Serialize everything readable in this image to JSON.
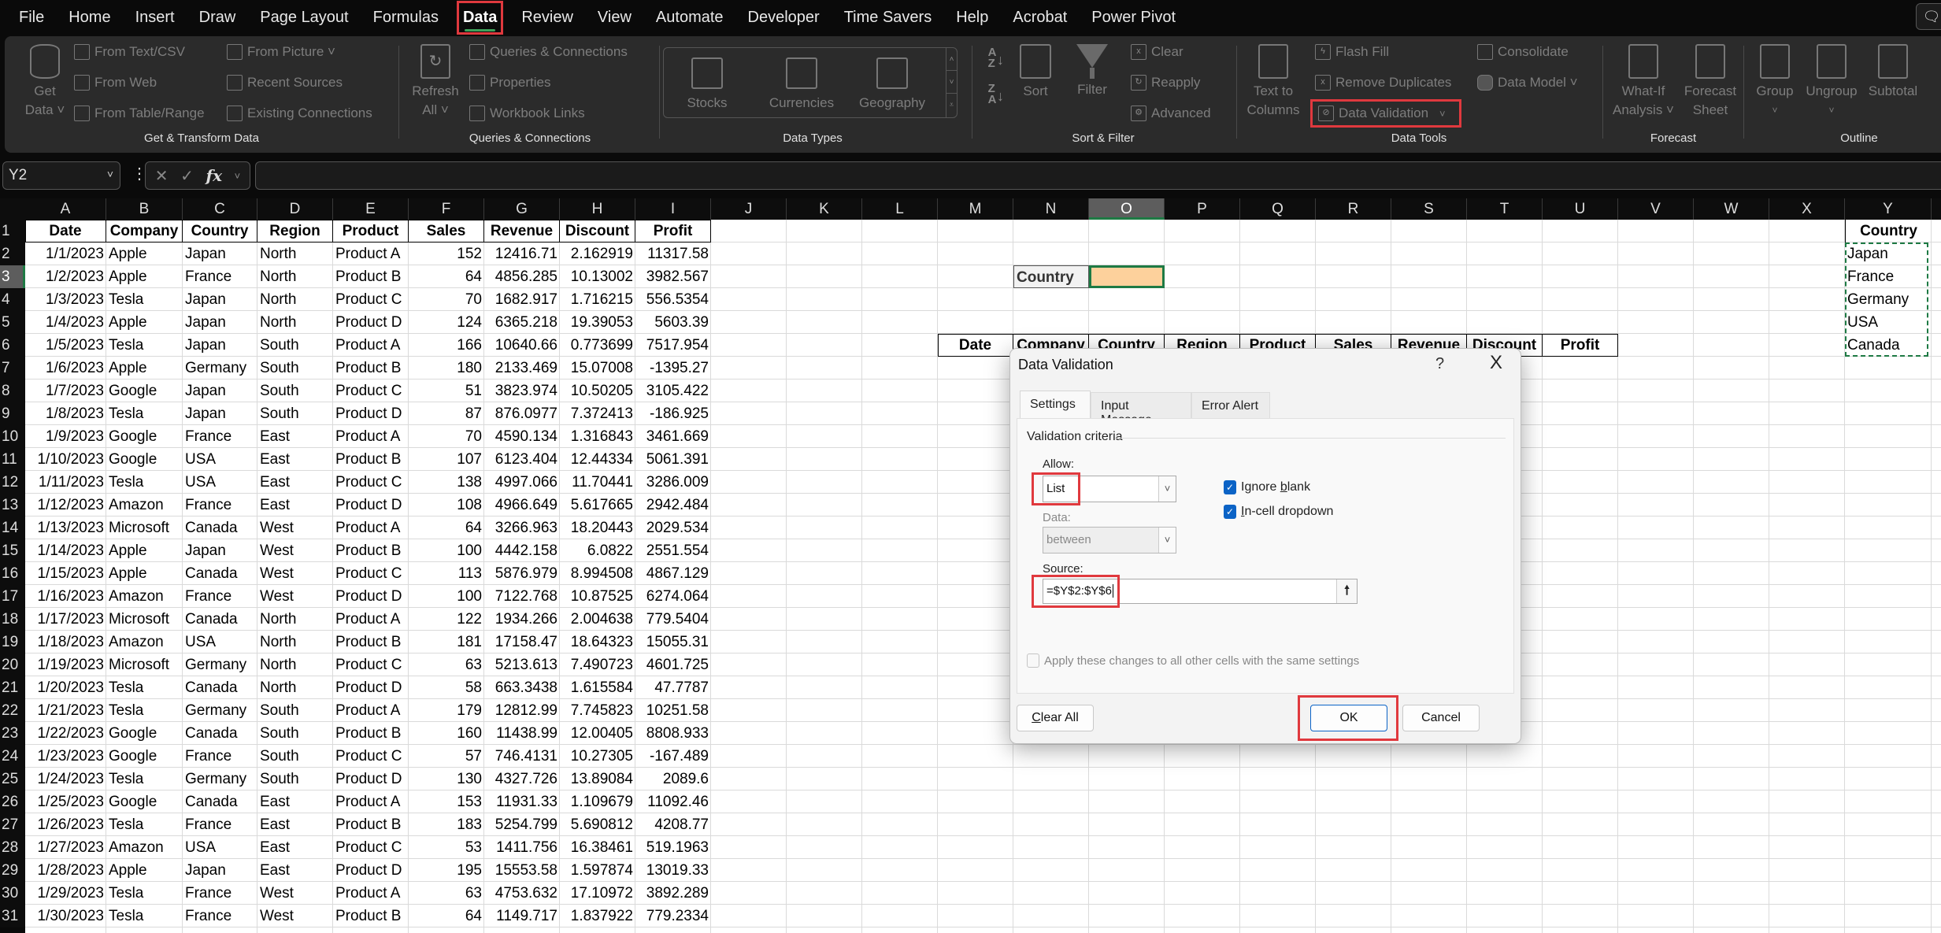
{
  "menu": {
    "items": [
      "File",
      "Home",
      "Insert",
      "Draw",
      "Page Layout",
      "Formulas",
      "Data",
      "Review",
      "View",
      "Automate",
      "Developer",
      "Time Savers",
      "Help",
      "Acrobat",
      "Power Pivot"
    ],
    "active": "Data"
  },
  "ribbon": {
    "get_transform": {
      "label": "Get & Transform Data",
      "get_data_1": "Get",
      "get_data_2": "Data ˅",
      "from_text_csv": "From Text/CSV",
      "from_web": "From Web",
      "from_table_range": "From Table/Range",
      "from_picture": "From Picture ˅",
      "recent_sources": "Recent Sources",
      "existing_connections": "Existing Connections"
    },
    "queries": {
      "label": "Queries & Connections",
      "refresh_1": "Refresh",
      "refresh_2": "All ˅",
      "queries_connections": "Queries & Connections",
      "properties": "Properties",
      "workbook_links": "Workbook Links"
    },
    "data_types": {
      "label": "Data Types",
      "stocks": "Stocks",
      "currencies": "Currencies",
      "geography": "Geography"
    },
    "sort_filter": {
      "label": "Sort & Filter",
      "sort_az": "A↓Z",
      "sort_za": "Z↓A",
      "sort": "Sort",
      "filter": "Filter",
      "clear": "Clear",
      "reapply": "Reapply",
      "advanced": "Advanced"
    },
    "data_tools": {
      "label": "Data Tools",
      "text_to_columns_1": "Text to",
      "text_to_columns_2": "Columns",
      "flash_fill": "Flash Fill",
      "remove_duplicates": "Remove Duplicates",
      "data_validation": "Data Validation",
      "consolidate": "Consolidate",
      "data_model": "Data Model ˅"
    },
    "forecast": {
      "label": "Forecast",
      "what_if_1": "What-If",
      "what_if_2": "Analysis ˅",
      "forecast_sheet_1": "Forecast",
      "forecast_sheet_2": "Sheet"
    },
    "outline": {
      "label": "Outline",
      "group": "Group",
      "ungroup": "Ungroup",
      "subtotal": "Subtotal"
    }
  },
  "formula_bar": {
    "name_box": "Y2",
    "formula": ""
  },
  "grid": {
    "columns": [
      "A",
      "B",
      "C",
      "D",
      "E",
      "F",
      "G",
      "H",
      "I",
      "J",
      "K",
      "L",
      "M",
      "N",
      "O",
      "P",
      "Q",
      "R",
      "S",
      "T",
      "U",
      "V",
      "W",
      "X",
      "Y"
    ],
    "selected_column": "O",
    "selected_row": 3,
    "row_numbers": [
      1,
      2,
      3,
      4,
      5,
      6,
      7,
      8,
      9,
      10,
      11,
      12,
      13,
      14,
      15,
      16,
      17,
      18,
      19,
      20,
      21,
      22,
      23,
      24,
      25,
      26,
      27,
      28,
      29,
      30,
      31
    ],
    "table_headers": [
      "Date",
      "Company",
      "Country",
      "Region",
      "Product",
      "Sales",
      "Revenue",
      "Discount",
      "Profit"
    ],
    "rows": [
      [
        "1/1/2023",
        "Apple",
        "Japan",
        "North",
        "Product A",
        "152",
        "12416.71",
        "2.162919",
        "11317.58"
      ],
      [
        "1/2/2023",
        "Apple",
        "France",
        "North",
        "Product B",
        "64",
        "4856.285",
        "10.13002",
        "3982.567"
      ],
      [
        "1/3/2023",
        "Tesla",
        "Japan",
        "North",
        "Product C",
        "70",
        "1682.917",
        "1.716215",
        "556.5354"
      ],
      [
        "1/4/2023",
        "Apple",
        "Japan",
        "North",
        "Product D",
        "124",
        "6365.218",
        "19.39053",
        "5603.39"
      ],
      [
        "1/5/2023",
        "Tesla",
        "Japan",
        "South",
        "Product A",
        "166",
        "10640.66",
        "0.773699",
        "7517.954"
      ],
      [
        "1/6/2023",
        "Apple",
        "Germany",
        "South",
        "Product B",
        "180",
        "2133.469",
        "15.07008",
        "-1395.27"
      ],
      [
        "1/7/2023",
        "Google",
        "Japan",
        "South",
        "Product C",
        "51",
        "3823.974",
        "10.50205",
        "3105.422"
      ],
      [
        "1/8/2023",
        "Tesla",
        "Japan",
        "South",
        "Product D",
        "87",
        "876.0977",
        "7.372413",
        "-186.925"
      ],
      [
        "1/9/2023",
        "Google",
        "France",
        "East",
        "Product A",
        "70",
        "4590.134",
        "1.316843",
        "3461.669"
      ],
      [
        "1/10/2023",
        "Google",
        "USA",
        "East",
        "Product B",
        "107",
        "6123.404",
        "12.44334",
        "5061.391"
      ],
      [
        "1/11/2023",
        "Tesla",
        "USA",
        "East",
        "Product C",
        "138",
        "4997.066",
        "11.70441",
        "3286.009"
      ],
      [
        "1/12/2023",
        "Amazon",
        "France",
        "East",
        "Product D",
        "108",
        "4966.649",
        "5.617665",
        "2942.484"
      ],
      [
        "1/13/2023",
        "Microsoft",
        "Canada",
        "West",
        "Product A",
        "64",
        "3266.963",
        "18.20443",
        "2029.534"
      ],
      [
        "1/14/2023",
        "Apple",
        "Japan",
        "West",
        "Product B",
        "100",
        "4442.158",
        "6.0822",
        "2551.554"
      ],
      [
        "1/15/2023",
        "Apple",
        "Canada",
        "West",
        "Product C",
        "113",
        "5876.979",
        "8.994508",
        "4867.129"
      ],
      [
        "1/16/2023",
        "Amazon",
        "France",
        "West",
        "Product D",
        "100",
        "7122.768",
        "10.87525",
        "6274.064"
      ],
      [
        "1/17/2023",
        "Microsoft",
        "Canada",
        "North",
        "Product A",
        "122",
        "1934.266",
        "2.004638",
        "779.5404"
      ],
      [
        "1/18/2023",
        "Amazon",
        "USA",
        "North",
        "Product B",
        "181",
        "17158.47",
        "18.64323",
        "15055.31"
      ],
      [
        "1/19/2023",
        "Microsoft",
        "Germany",
        "North",
        "Product C",
        "63",
        "5213.613",
        "7.490723",
        "4601.725"
      ],
      [
        "1/20/2023",
        "Tesla",
        "Canada",
        "North",
        "Product D",
        "58",
        "663.3438",
        "1.615584",
        "47.7787"
      ],
      [
        "1/21/2023",
        "Tesla",
        "Germany",
        "South",
        "Product A",
        "179",
        "12812.99",
        "7.745823",
        "10251.58"
      ],
      [
        "1/22/2023",
        "Google",
        "Canada",
        "South",
        "Product B",
        "160",
        "11438.99",
        "12.00405",
        "8808.933"
      ],
      [
        "1/23/2023",
        "Google",
        "France",
        "South",
        "Product C",
        "57",
        "746.4131",
        "10.27305",
        "-167.489"
      ],
      [
        "1/24/2023",
        "Tesla",
        "Germany",
        "South",
        "Product D",
        "130",
        "4327.726",
        "13.89084",
        "2089.6"
      ],
      [
        "1/25/2023",
        "Google",
        "Canada",
        "East",
        "Product A",
        "153",
        "11931.33",
        "1.109679",
        "11092.46"
      ],
      [
        "1/26/2023",
        "Tesla",
        "France",
        "East",
        "Product B",
        "183",
        "5254.799",
        "5.690812",
        "4208.77"
      ],
      [
        "1/27/2023",
        "Amazon",
        "USA",
        "East",
        "Product C",
        "53",
        "1411.756",
        "16.38461",
        "519.1963"
      ],
      [
        "1/28/2023",
        "Apple",
        "Japan",
        "East",
        "Product D",
        "195",
        "15553.58",
        "1.597874",
        "13019.33"
      ],
      [
        "1/29/2023",
        "Tesla",
        "France",
        "West",
        "Product A",
        "63",
        "4753.632",
        "17.10972",
        "3892.289"
      ],
      [
        "1/30/2023",
        "Tesla",
        "France",
        "West",
        "Product B",
        "64",
        "1149.717",
        "1.837922",
        "779.2334"
      ]
    ],
    "filter_label": "Country",
    "filter_value": "",
    "filter_cell_color": "#fdd19c",
    "lookup_headers": [
      "Date",
      "Company",
      "Country",
      "Region",
      "Product",
      "Sales",
      "Revenue",
      "Discount",
      "Profit"
    ],
    "country_list_header": "Country",
    "country_list": [
      "Japan",
      "France",
      "Germany",
      "USA",
      "Canada"
    ]
  },
  "dialog": {
    "title": "Data Validation",
    "help": "?",
    "close": "X",
    "tabs": [
      "Settings",
      "Input Message",
      "Error Alert"
    ],
    "active_tab": "Settings",
    "section": "Validation criteria",
    "allow_label": "Allow:",
    "allow_value": "List",
    "data_label": "Data:",
    "data_value": "between",
    "ignore_blank_pre": "Ignore ",
    "ignore_blank_u": "b",
    "ignore_blank_post": "lank",
    "ignore_blank_checked": true,
    "in_cell_u": "I",
    "in_cell_post": "n-cell dropdown",
    "in_cell_checked": true,
    "source_label": "Source:",
    "source_value": "=$Y$2:$Y$6",
    "apply_all": "Apply these changes to all other cells with the same settings",
    "apply_all_checked": false,
    "clear_all_u": "C",
    "clear_all_post": "lear All",
    "ok": "OK",
    "cancel": "Cancel"
  },
  "colors": {
    "highlight": "#e0393e",
    "selection": "#1e7a44",
    "checkbox": "#0b63c6"
  }
}
